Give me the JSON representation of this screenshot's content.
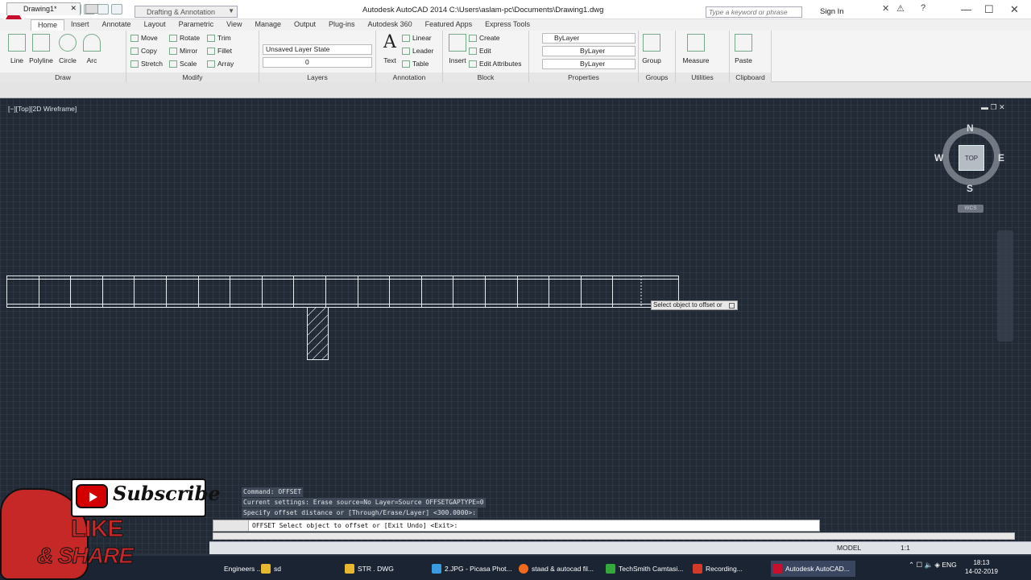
{
  "titlebar": {
    "title": "Autodesk AutoCAD 2014     C:\\Users\\aslam-pc\\Documents\\Drawing1.dwg",
    "workspace": "Drafting & Annotation",
    "search_placeholder": "Type a keyword or phrase",
    "signin": "Sign In"
  },
  "tabs": [
    "Home",
    "Insert",
    "Annotate",
    "Layout",
    "Parametric",
    "View",
    "Manage",
    "Output",
    "Plug-ins",
    "Autodesk 360",
    "Featured Apps",
    "Express Tools"
  ],
  "ribbon": {
    "draw": {
      "title": "Draw",
      "line": "Line",
      "polyline": "Polyline",
      "circle": "Circle",
      "arc": "Arc"
    },
    "modify": {
      "title": "Modify",
      "move": "Move",
      "rotate": "Rotate",
      "trim": "Trim",
      "copy": "Copy",
      "mirror": "Mirror",
      "fillet": "Fillet",
      "stretch": "Stretch",
      "scale": "Scale",
      "array": "Array"
    },
    "layers": {
      "title": "Layers",
      "layer_state": "Unsaved Layer State",
      "current_layer": "0"
    },
    "annotation": {
      "title": "Annotation",
      "text": "Text",
      "linear": "Linear",
      "leader": "Leader",
      "table": "Table"
    },
    "block": {
      "title": "Block",
      "insert": "Insert",
      "create": "Create",
      "edit": "Edit",
      "edit_attributes": "Edit Attributes"
    },
    "properties": {
      "title": "Properties",
      "color": "ByLayer",
      "linetype": "ByLayer",
      "lineweight": "ByLayer"
    },
    "groups": {
      "title": "Groups",
      "group": "Group"
    },
    "utilities": {
      "title": "Utilities",
      "measure": "Measure"
    },
    "clipboard": {
      "title": "Clipboard",
      "paste": "Paste"
    }
  },
  "doc_tab": "Drawing1*",
  "viewport_label": "[−][Top][2D Wireframe]",
  "viewcube": {
    "top": "TOP",
    "n": "N",
    "s": "S",
    "e": "E",
    "w": "W",
    "wcs": "WCS"
  },
  "tooltip": "Select object to offset or",
  "command": {
    "history": [
      "Command:  OFFSET",
      "Current settings: Erase source=No  Layer=Source  OFFSETGAPTYPE=0",
      "Specify offset distance or [Through/Erase/Layer] <300.0000>:"
    ],
    "prompt": "OFFSET Select object to offset or [Exit Undo] <Exit>:"
  },
  "status": {
    "model": "MODEL",
    "scale": "1:1"
  },
  "taskbar": {
    "items": [
      {
        "label": "Engineers ...",
        "color": "#2a7fd4"
      },
      {
        "label": "sd",
        "color": "#e8b830"
      },
      {
        "label": "STR . DWG",
        "color": "#e8b830"
      },
      {
        "label": "2.JPG - Picasa Phot...",
        "color": "#3a9be0"
      },
      {
        "label": "staad & autocad fil...",
        "color": "#f06a1d"
      },
      {
        "label": "TechSmith Camtasi...",
        "color": "#35a83a"
      },
      {
        "label": "Recording...",
        "color": "#d23a2a"
      },
      {
        "label": "Autodesk AutoCAD...",
        "color": "#c8102e"
      }
    ],
    "lang": "ENG",
    "time": "18:13",
    "date": "14-02-2019"
  },
  "overlay": {
    "subscribe": "Subscribe",
    "like": "LIKE",
    "share": "& SHARE"
  }
}
